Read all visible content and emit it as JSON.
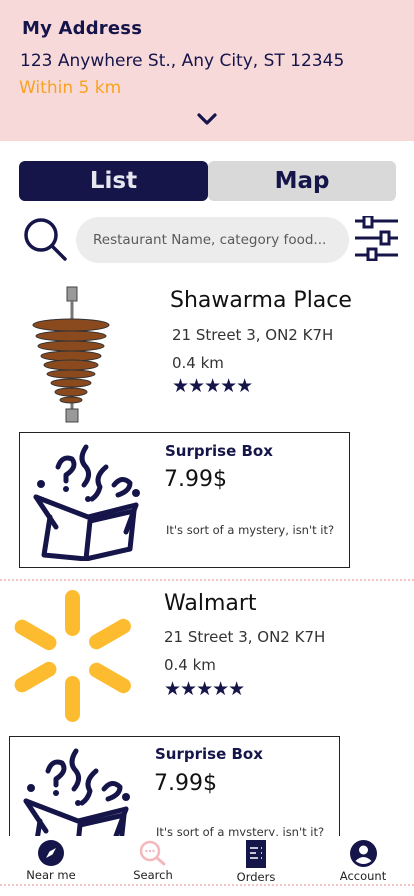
{
  "header": {
    "title": "My Address",
    "address": "123 Anywhere St., Any City, ST 12345",
    "range": "Within 5 km"
  },
  "tabs": [
    {
      "label": "List",
      "active": true
    },
    {
      "label": "Map",
      "active": false
    }
  ],
  "search": {
    "placeholder": "Restaurant Name, category food..."
  },
  "restaurants": [
    {
      "name": "Shawarma Place",
      "address": "21 Street 3, ON2 K7H",
      "distance": "0.4 km",
      "rating": 5,
      "stars": "★★★★★",
      "offer": {
        "title": "Surprise Box",
        "price": "7.99$",
        "description": "It's sort of a mystery, isn't it?"
      }
    },
    {
      "name": "Walmart",
      "address": "21 Street 3, ON2 K7H",
      "distance": "0.4 km",
      "rating": 5,
      "stars": "★★★★★",
      "offer": {
        "title": "Surprise Box",
        "price": "7.99$",
        "description": "It's sort of a mystery, isn't it?"
      }
    }
  ],
  "nav": [
    {
      "label": "Near me",
      "icon": "compass-icon"
    },
    {
      "label": "Search",
      "icon": "search-icon",
      "active": true
    },
    {
      "label": "Orders",
      "icon": "receipt-icon"
    },
    {
      "label": "Account",
      "icon": "account-icon"
    }
  ],
  "colors": {
    "primary": "#15154a",
    "header_bg": "#f8d9da",
    "accent": "#f8a21f",
    "active_nav": "#f4b8bc",
    "walmart": "#fdbb30"
  }
}
